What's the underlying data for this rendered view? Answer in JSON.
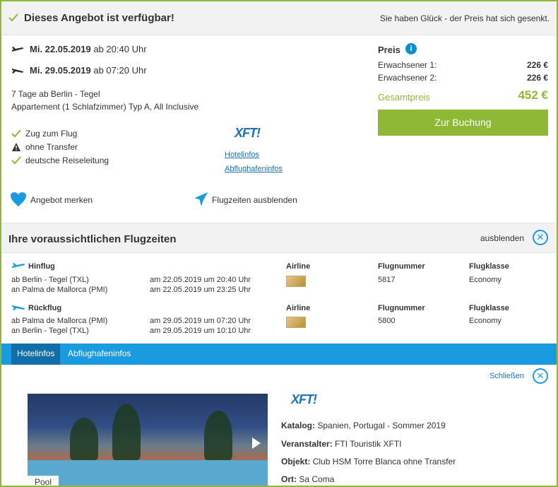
{
  "header": {
    "title": "Dieses Angebot ist verfügbar!",
    "note": "Sie haben Glück - der Preis hat sich gesenkt."
  },
  "offer": {
    "outbound_date": "Mi. 22.05.2019",
    "outbound_time": "ab 20:40 Uhr",
    "return_date": "Mi. 29.05.2019",
    "return_time": "ab 07:20 Uhr",
    "duration": "7 Tage ab Berlin - Tegel",
    "room": "Appartement (1 Schlafzimmer) Typ A, All Inclusive",
    "features": [
      {
        "icon": "check-icon",
        "label": "Zug zum Flug"
      },
      {
        "icon": "warning-icon",
        "label": "ohne Transfer"
      },
      {
        "icon": "check-icon",
        "label": "deutsche Reiseleitung"
      }
    ],
    "logo_text": "XFTI",
    "links": {
      "hotel": "Hotelinfos",
      "airport": "Abflughafeninfos"
    },
    "actions": {
      "remember": "Angebot merken",
      "hide_flights": "Flugzeiten ausblenden"
    }
  },
  "price": {
    "heading": "Preis",
    "rows": [
      {
        "label": "Erwachsener 1:",
        "value": "226 €"
      },
      {
        "label": "Erwachsener 2:",
        "value": "226 €"
      }
    ],
    "total_label": "Gesamtpreis",
    "total_value": "452 €",
    "book_button": "Zur Buchung"
  },
  "flight_times": {
    "title": "Ihre voraussichtlichen Flugzeiten",
    "hide_label": "ausblenden",
    "segments": [
      {
        "label": "Hinflug",
        "from": "ab Berlin - Tegel (TXL)",
        "to": "an Palma de Mallorca (PMI)",
        "dep": "am 22.05.2019 um 20:40 Uhr",
        "arr": "am 22.05.2019 um 23:25 Uhr",
        "airline_header": "Airline",
        "flight_header": "Flugnummer",
        "flight_number": "5817",
        "class_header": "Flugklasse",
        "class": "Economy"
      },
      {
        "label": "Rückflug",
        "from": "ab Palma de Mallorca (PMI)",
        "to": "an Berlin - Tegel (TXL)",
        "dep": "am 29.05.2019 um 07:20 Uhr",
        "arr": "am 29.05.2019 um 10:10 Uhr",
        "airline_header": "Airline",
        "flight_header": "Flugnummer",
        "flight_number": "5800",
        "class_header": "Flugklasse",
        "class": "Economy"
      }
    ]
  },
  "hotel_tabs": {
    "tabs": [
      "Hotelinfos",
      "Abflughafeninfos"
    ],
    "close_label": "Schließen",
    "image_tag": "Pool",
    "info": [
      {
        "key": "Katalog:",
        "value": "Spanien, Portugal - Sommer 2019"
      },
      {
        "key": "Veranstalter:",
        "value": "FTI Touristik XFTI"
      },
      {
        "key": "Objekt:",
        "value": "Club HSM Torre Blanca ohne Transfer"
      },
      {
        "key": "Ort:",
        "value": "Sa Coma"
      }
    ]
  },
  "colors": {
    "accent_green": "#8fb836",
    "accent_blue": "#1a9be0",
    "link_blue": "#1a73b8"
  }
}
